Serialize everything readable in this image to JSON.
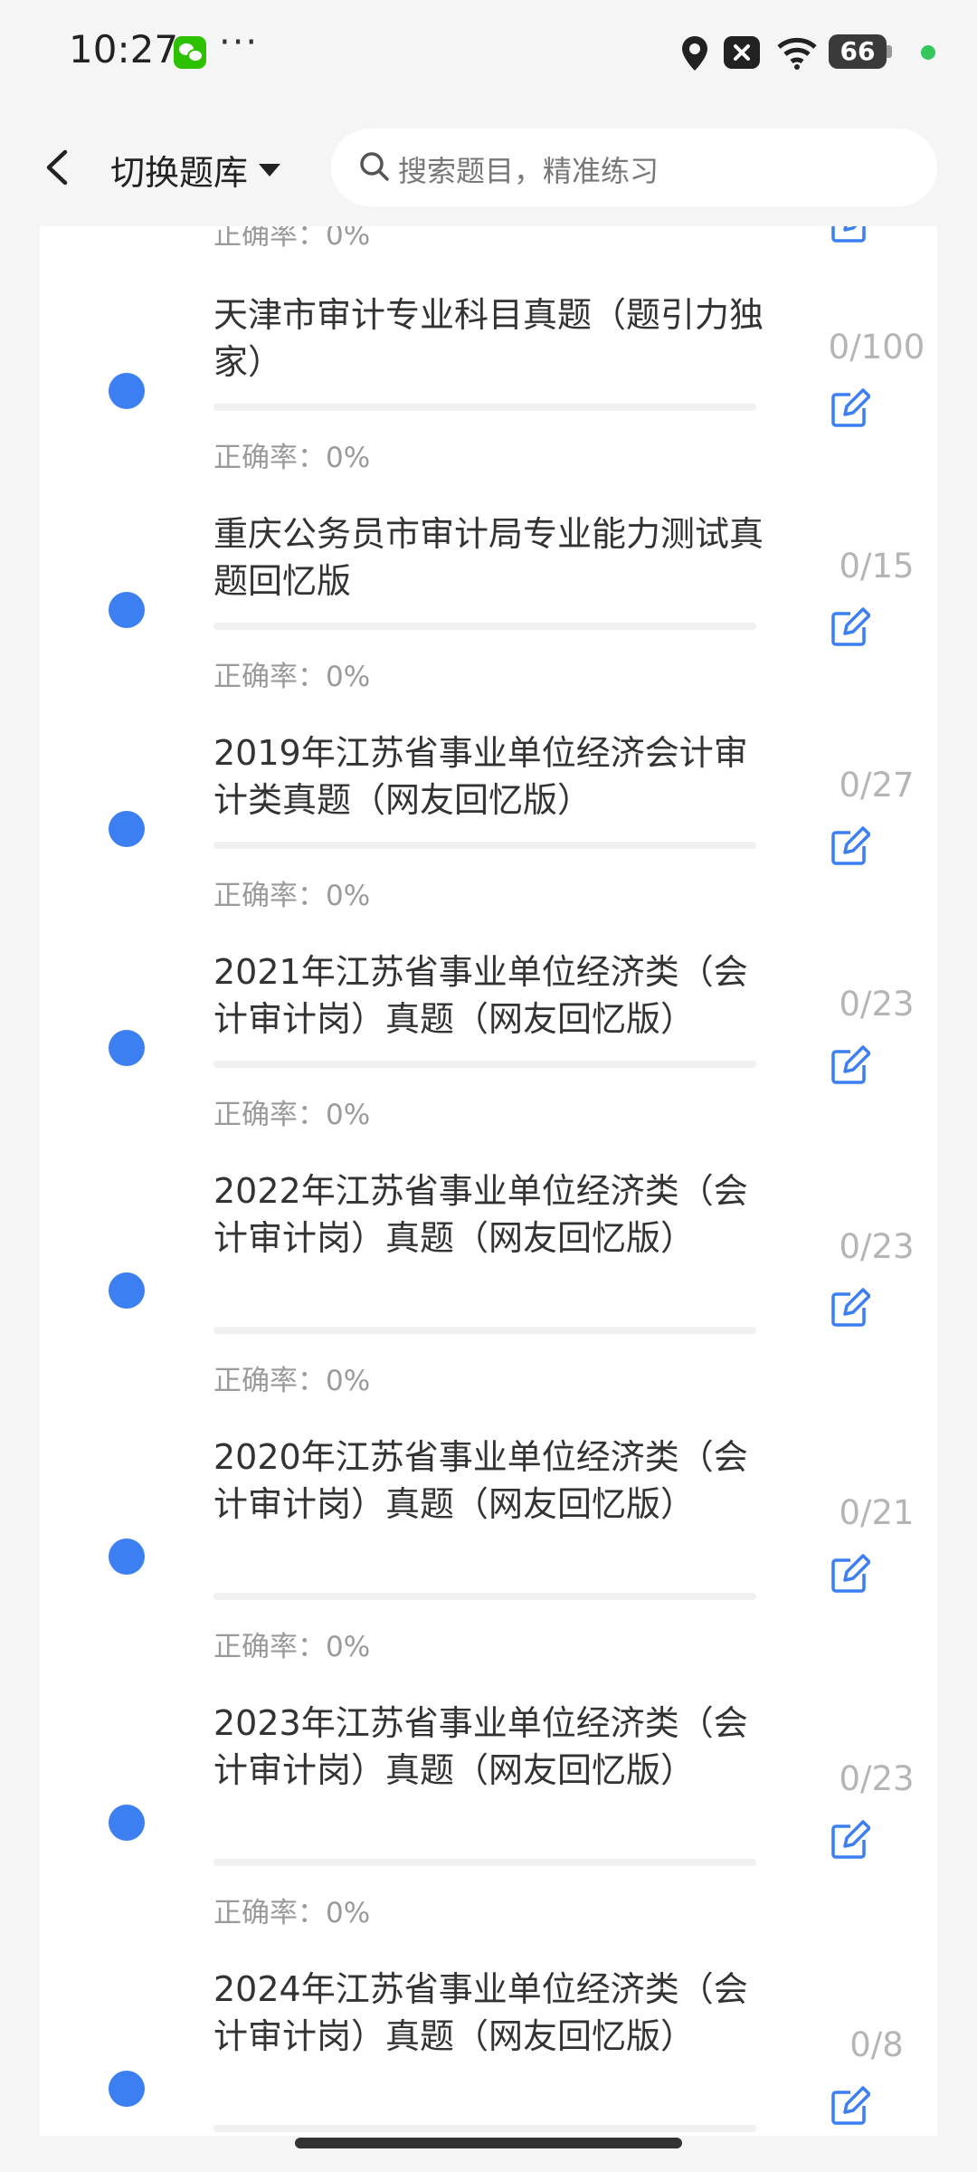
{
  "status_bar": {
    "time": "10:27",
    "battery": "66",
    "icons": [
      "wechat-icon",
      "more-dots-icon",
      "location-icon",
      "close-box-icon",
      "wifi-icon",
      "battery-icon",
      "green-dot-icon"
    ]
  },
  "header": {
    "switch_label": "切换题库",
    "search_placeholder": "搜索题目，精准练习"
  },
  "list": {
    "partial_item": {
      "accuracy": "正确率：0%"
    },
    "items": [
      {
        "title": "天津市审计专业科目真题（题引力独家）",
        "accuracy": "正确率：0%",
        "count": "0/100"
      },
      {
        "title": "重庆公务员市审计局专业能力测试真题回忆版",
        "accuracy": "正确率：0%",
        "count": "0/15"
      },
      {
        "title": "2019年江苏省事业单位经济会计审计类真题（网友回忆版）",
        "accuracy": "正确率：0%",
        "count": "0/27"
      },
      {
        "title": "2021年江苏省事业单位经济类（会计审计岗）真题（网友回忆版）",
        "accuracy": "正确率：0%",
        "count": "0/23"
      },
      {
        "title": "2022年江苏省事业单位经济类（会计审计岗）真题（网友回忆版）",
        "accuracy": "正确率：0%",
        "count": "0/23"
      },
      {
        "title": "2020年江苏省事业单位经济类（会计审计岗）真题（网友回忆版）",
        "accuracy": "正确率：0%",
        "count": "0/21"
      },
      {
        "title": "2023年江苏省事业单位经济类（会计审计岗）真题（网友回忆版）",
        "accuracy": "正确率：0%",
        "count": "0/23"
      },
      {
        "title": "2024年江苏省事业单位经济类（会计审计岗）真题（网友回忆版）",
        "accuracy": "",
        "count": "0/8"
      }
    ]
  },
  "colors": {
    "accent": "#3b7ff2",
    "muted": "#9a9a9a"
  }
}
